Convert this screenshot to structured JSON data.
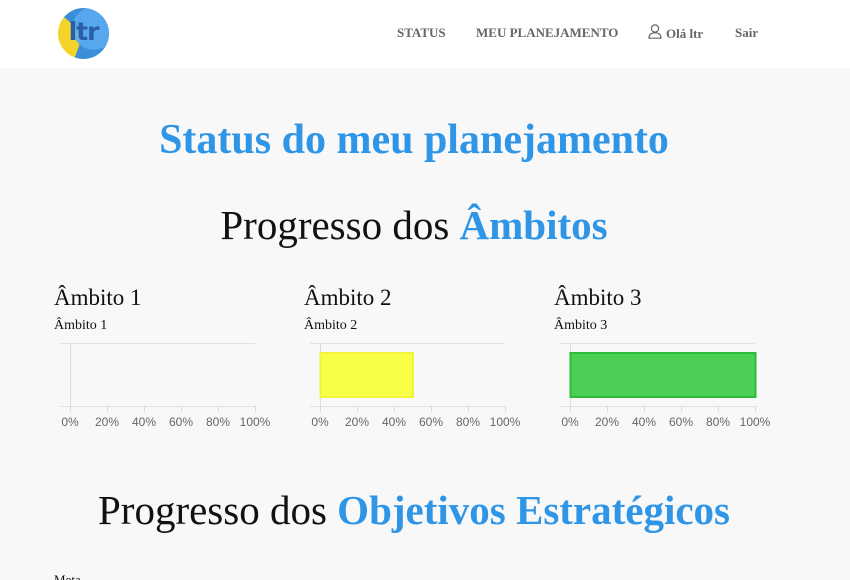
{
  "nav": {
    "logo_text": "ltr",
    "status": "STATUS",
    "planning": "MEU PLANEJAMENTO",
    "user_greeting": "Olá ltr",
    "logout": "Sair"
  },
  "page_title": "Status do meu planejamento",
  "sections": {
    "ambitos": {
      "prefix": "Progresso dos ",
      "highlight": "Âmbitos"
    },
    "objetivos": {
      "prefix": "Progresso dos ",
      "highlight": "Objetivos Estratégicos"
    }
  },
  "ambitos": [
    {
      "title": "Âmbito 1",
      "subtitle": "Âmbito 1"
    },
    {
      "title": "Âmbito 2",
      "subtitle": "Âmbito 2"
    },
    {
      "title": "Âmbito 3",
      "subtitle": "Âmbito 3"
    }
  ],
  "meta_label": "Meta",
  "chart_data": [
    {
      "type": "bar",
      "orientation": "horizontal",
      "title": "Âmbito 1",
      "values": [
        0
      ],
      "xlim": [
        0,
        100
      ],
      "ticks": [
        "0%",
        "20%",
        "40%",
        "60%",
        "80%",
        "100%"
      ],
      "color": "#f8f8f8",
      "border": "#f8f8f8"
    },
    {
      "type": "bar",
      "orientation": "horizontal",
      "title": "Âmbito 2",
      "values": [
        50
      ],
      "xlim": [
        0,
        100
      ],
      "ticks": [
        "0%",
        "20%",
        "40%",
        "60%",
        "80%",
        "100%"
      ],
      "color": "#f8ff47",
      "border": "#f3f33a"
    },
    {
      "type": "bar",
      "orientation": "horizontal",
      "title": "Âmbito 3",
      "values": [
        100
      ],
      "xlim": [
        0,
        100
      ],
      "ticks": [
        "0%",
        "20%",
        "40%",
        "60%",
        "80%",
        "100%"
      ],
      "color": "#4bd055",
      "border": "#2dbb3a"
    }
  ]
}
